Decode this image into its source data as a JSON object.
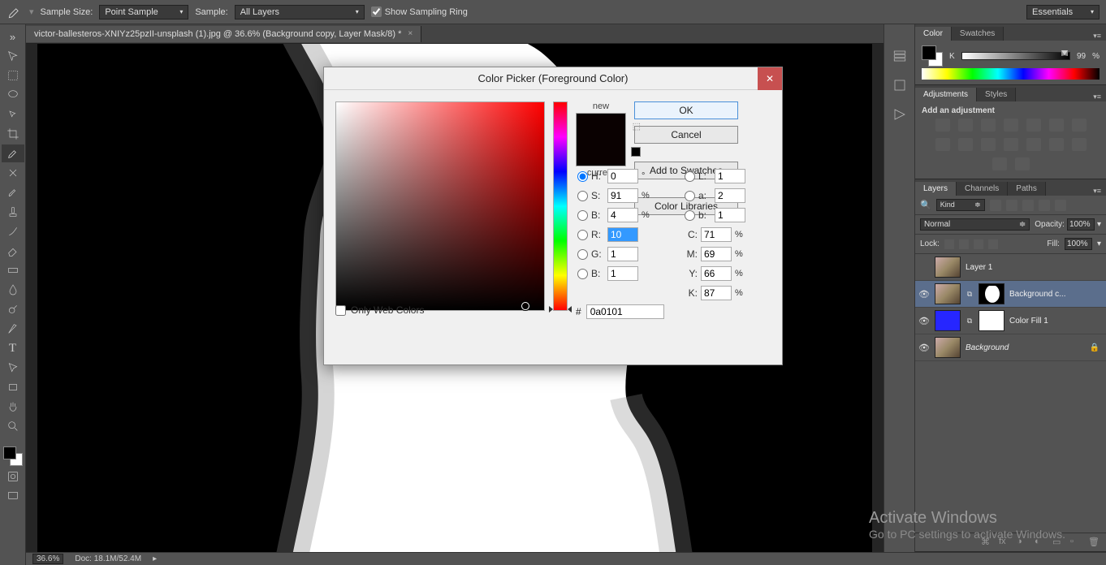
{
  "options_bar": {
    "sample_size_label": "Sample Size:",
    "sample_size_value": "Point Sample",
    "sample_label": "Sample:",
    "sample_value": "All Layers",
    "show_sampling_ring": "Show Sampling Ring",
    "workspace": "Essentials"
  },
  "document": {
    "tab_title": "victor-ballesteros-XNIYz25pzII-unsplash (1).jpg @ 36.6% (Background copy, Layer Mask/8) *"
  },
  "color_panel": {
    "tab_color": "Color",
    "tab_swatches": "Swatches",
    "k_label": "K",
    "k_value": "99",
    "k_unit": "%"
  },
  "adjustments_panel": {
    "tab_adjustments": "Adjustments",
    "tab_styles": "Styles",
    "heading": "Add an adjustment"
  },
  "layers_panel": {
    "tab_layers": "Layers",
    "tab_channels": "Channels",
    "tab_paths": "Paths",
    "kind_label": "Kind",
    "blend_mode": "Normal",
    "opacity_label": "Opacity:",
    "opacity_value": "100%",
    "lock_label": "Lock:",
    "fill_label": "Fill:",
    "fill_value": "100%",
    "layers": [
      {
        "name": "Layer 1",
        "visible": false,
        "mask": false,
        "thumb": "img"
      },
      {
        "name": "Background c...",
        "visible": true,
        "mask": true,
        "thumb": "img",
        "selected": true
      },
      {
        "name": "Color Fill 1",
        "visible": true,
        "mask": true,
        "thumb": "blue",
        "mask_white": true
      },
      {
        "name": "Background",
        "visible": true,
        "mask": false,
        "thumb": "img",
        "italic": true,
        "locked": true
      }
    ]
  },
  "status_bar": {
    "zoom": "36.6%",
    "doc_info": "Doc: 18.1M/52.4M"
  },
  "color_picker": {
    "title": "Color Picker (Foreground Color)",
    "new_label": "new",
    "current_label": "current",
    "ok": "OK",
    "cancel": "Cancel",
    "add_swatches": "Add to Swatches",
    "color_libraries": "Color Libraries",
    "H": "0",
    "H_unit": "°",
    "S": "91",
    "S_unit": "%",
    "Bv": "4",
    "Bv_unit": "%",
    "R": "10",
    "G": "1",
    "Bb": "1",
    "L": "1",
    "a": "2",
    "b": "1",
    "C": "71",
    "C_unit": "%",
    "M": "69",
    "M_unit": "%",
    "Y": "66",
    "Y_unit": "%",
    "K": "87",
    "K_unit": "%",
    "hex_prefix": "#",
    "hex": "0a0101",
    "web_only": "Only Web Colors"
  },
  "watermark": {
    "title": "Activate Windows",
    "sub": "Go to PC settings to activate Windows."
  }
}
